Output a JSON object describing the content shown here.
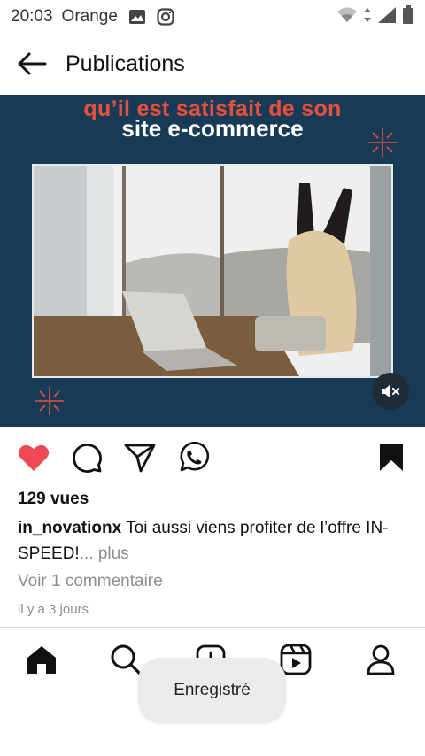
{
  "statusbar": {
    "time": "20:03",
    "carrier": "Orange",
    "icons": [
      "image-icon",
      "instagram-icon",
      "wifi-icon",
      "signal-icon",
      "battery-icon"
    ]
  },
  "header": {
    "title": "Publications",
    "back_icon": "arrow-left-icon"
  },
  "post": {
    "overlay_line1": "qu’il est satisfait de son",
    "overlay_line2": "site e-commerce",
    "mute_icon": "speaker-muted-icon",
    "views": "129 vues",
    "username": "in_novationx",
    "caption_text": "Toi aussi viens profiter de l’offre IN-SPEED!",
    "more": "... plus",
    "comments": "Voir 1 commentaire",
    "ago": "il y a 3 jours",
    "liked": true
  },
  "actions": [
    "heart-icon",
    "comment-icon",
    "share-icon",
    "whatsapp-icon",
    "bookmark-icon"
  ],
  "bottom_nav": [
    "home-icon",
    "search-icon",
    "add-post-icon",
    "reels-icon",
    "profile-icon"
  ],
  "toast": "Enregistré",
  "colors": {
    "accent_red": "#ed4956",
    "media_bg": "#173a56",
    "overlay_orange": "#e9503a",
    "muted_text": "#8e8e8e"
  }
}
